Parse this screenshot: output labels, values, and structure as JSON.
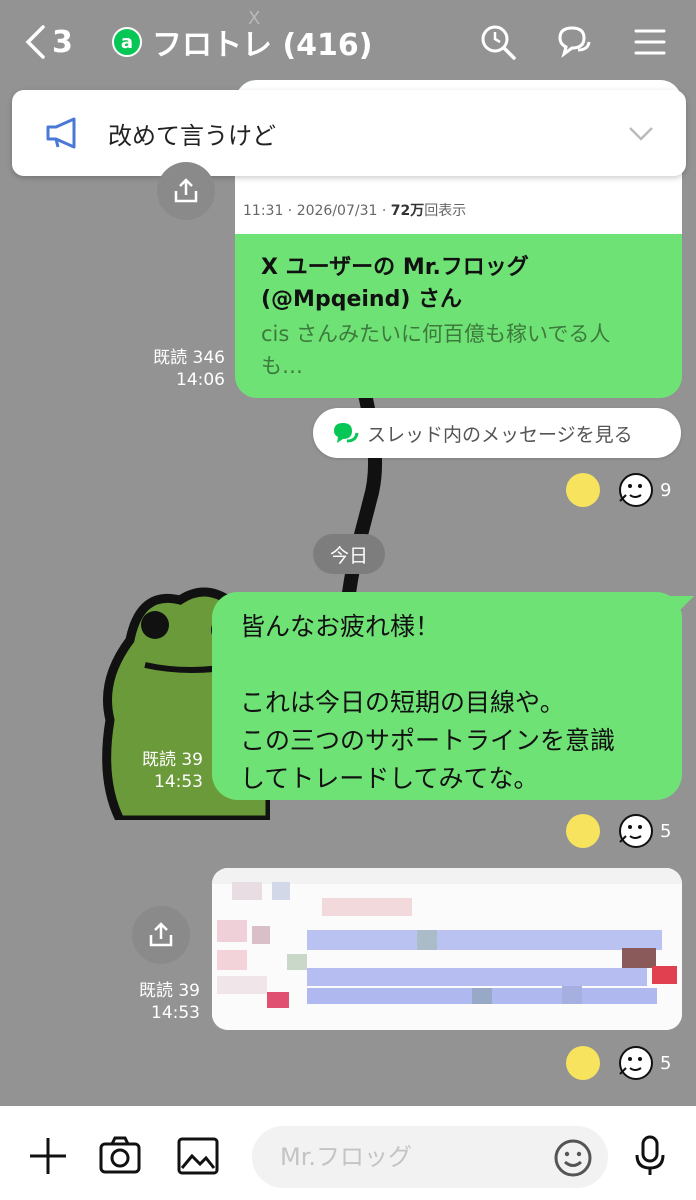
{
  "header": {
    "back_count": "3",
    "badge": "a",
    "title": "フロトレ (416)",
    "icons": [
      "search-icon",
      "thread-chat-icon",
      "menu-icon"
    ]
  },
  "announcement": {
    "text": "改めて言うけど",
    "icon": "megaphone-icon"
  },
  "messages": {
    "card": {
      "date_time": "11:31 · 2026/07/31 · ",
      "views_num": "72万",
      "views_suffix": "回表示",
      "title_line1": "X ユーザーの Mr.フロッグ",
      "title_line2": "(@Mpqeind) さん",
      "desc_line1": "cis さんみたいに何百億も稼いでる人",
      "desc_line2": "も…",
      "read": "既読 346",
      "time": "14:06"
    },
    "thread_link": "スレッド内のメッセージを見る",
    "reaction1_count": "9",
    "date_divider": "今日",
    "text_message": {
      "body": "皆んなお疲れ様！\n\nこれは今日の短期の目線や。\nこの三つのサポートラインを意識\nしてトレードしてみてな。",
      "read": "既読 39",
      "time": "14:53"
    },
    "reaction2_count": "5",
    "image_message": {
      "read": "既読 39",
      "time": "14:53"
    },
    "reaction3_count": "5"
  },
  "input": {
    "placeholder": "Mr.フロッグ"
  },
  "colors": {
    "bubble": "#6fe276",
    "line_green": "#06c755",
    "background": "#939393"
  }
}
